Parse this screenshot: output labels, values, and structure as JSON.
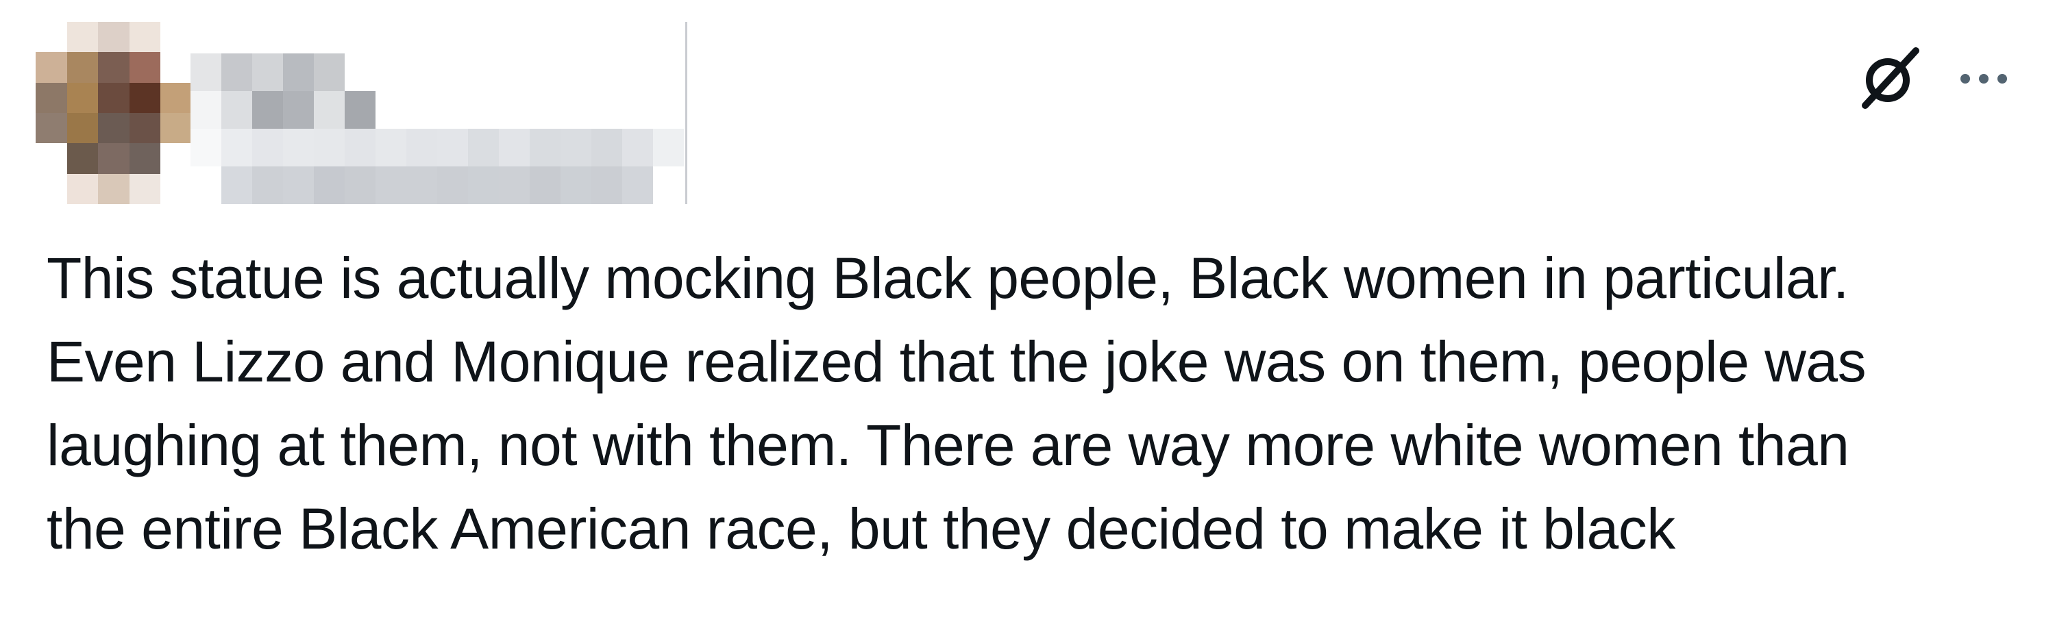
{
  "post": {
    "author": {
      "name": "",
      "handle": "",
      "avatar_censored": true
    },
    "icons": {
      "grok": "grok-icon",
      "more": "more-options-icon"
    },
    "text_lines": [
      "This statue is actually mocking Black people, Black women in particular.",
      "Even Lizzo and Monique realized that the joke was on them, people was",
      "laughing at them, not with them. There are way more white women than",
      "the entire Black American race, but they decided to make it black"
    ]
  },
  "colors": {
    "text": "#0f1419",
    "icon": "#536471",
    "background": "#ffffff",
    "divider": "#c9ccd1"
  }
}
